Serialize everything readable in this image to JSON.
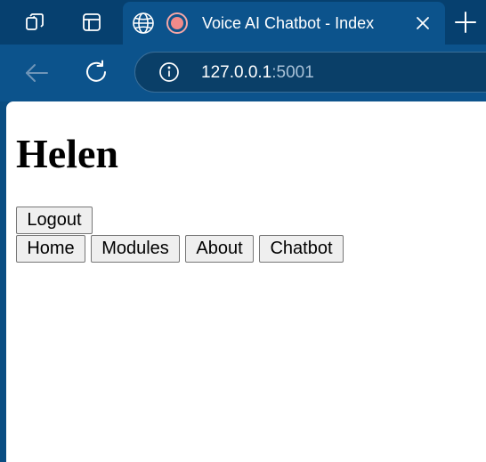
{
  "browser": {
    "tab": {
      "title": "Voice AI Chatbot - Index"
    },
    "address_bar": {
      "host": "127.0.0.1",
      "port": ":5001"
    },
    "icons": {
      "workspaces": "workspaces-icon",
      "tab_actions": "tab-actions-icon",
      "favicon": "globe-icon",
      "recording": "recording-icon",
      "close_tab": "close-icon",
      "new_tab": "plus-icon",
      "back": "back-arrow-icon",
      "reload": "reload-icon",
      "site_info": "info-icon"
    },
    "colors": {
      "tab_strip": "#06406f",
      "toolbar": "#0c538c",
      "recording_dot": "#f08a8a"
    }
  },
  "page": {
    "username": "Helen",
    "logout_label": "Logout",
    "nav": [
      "Home",
      "Modules",
      "About",
      "Chatbot"
    ]
  }
}
